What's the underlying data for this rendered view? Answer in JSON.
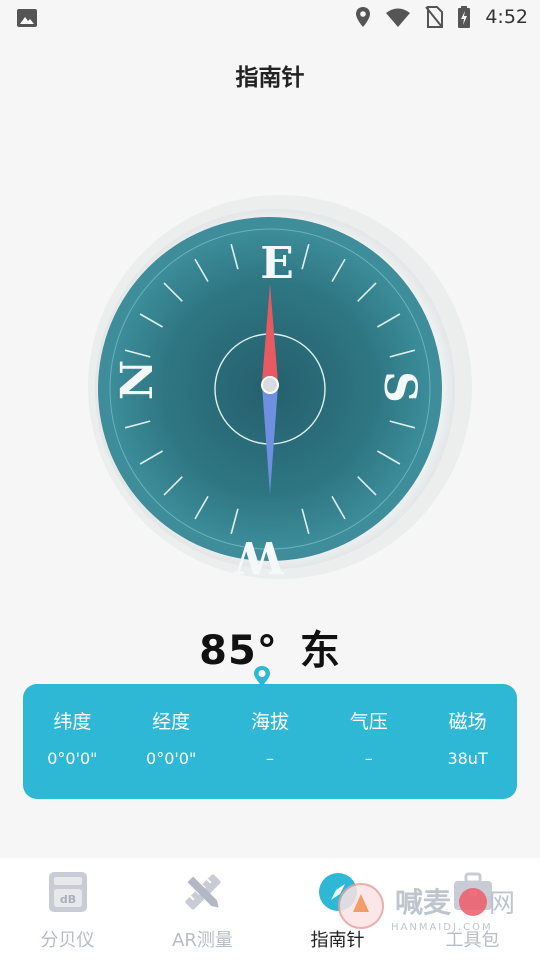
{
  "status_bar": {
    "time": "4:52"
  },
  "page": {
    "title": "指南针"
  },
  "compass": {
    "labels": {
      "north": "N",
      "east": "E",
      "south": "S",
      "west": "W"
    },
    "heading_degrees": 85,
    "colors": {
      "face": "#3a8896",
      "face_dark": "#24606c",
      "needle_north": "#e85a62",
      "needle_south": "#6f8fe0",
      "rim": "#e8ecec"
    }
  },
  "readout": {
    "degrees": "85°",
    "direction": "东"
  },
  "info": [
    {
      "label": "纬度",
      "value": "0°0'0\""
    },
    {
      "label": "经度",
      "value": "0°0'0\""
    },
    {
      "label": "海拔",
      "value": "–"
    },
    {
      "label": "气压",
      "value": "–"
    },
    {
      "label": "磁场",
      "value": "38uT"
    }
  ],
  "nav": {
    "items": [
      {
        "label": "分贝仪",
        "icon": "decibel-icon"
      },
      {
        "label": "AR测量",
        "icon": "ruler-pencil-icon"
      },
      {
        "label": "指南针",
        "icon": "compass-icon"
      },
      {
        "label": "工具包",
        "icon": "toolkit-icon"
      }
    ],
    "active_index": 2,
    "accent_color": "#2fb8d6"
  },
  "watermark": {
    "text": "喊麦",
    "site_text": "网",
    "sub_text": "HANMAIDJ.COM"
  }
}
